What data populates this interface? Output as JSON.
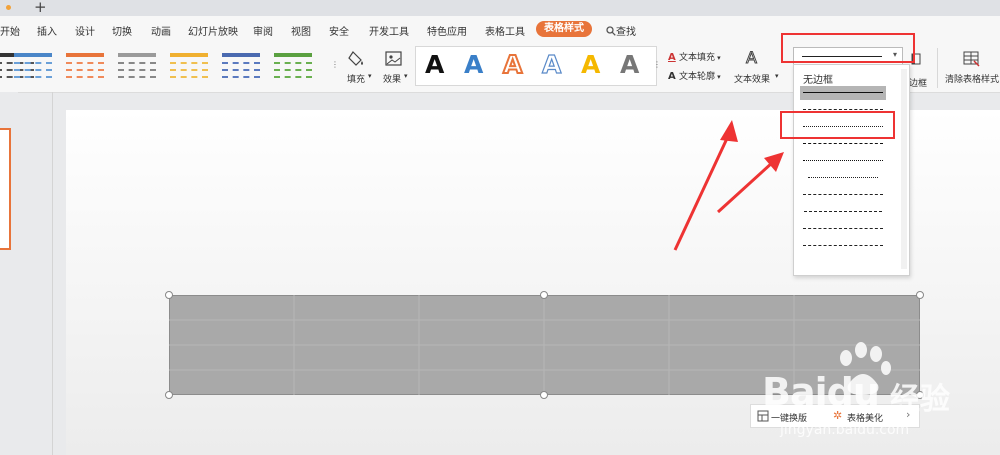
{
  "menu": {
    "items": [
      "开始",
      "插入",
      "设计",
      "切换",
      "动画",
      "幻灯片放映",
      "审阅",
      "视图",
      "安全",
      "开发工具",
      "特色应用",
      "表格工具"
    ],
    "active": "表格样式",
    "search": "查找"
  },
  "ribbon": {
    "fill_label": "填充",
    "effect_label": "效果",
    "text_fill_label": "文本填充",
    "text_outline_label": "文本轮廓",
    "text_effect_label": "文本效果",
    "border_label": "边框",
    "clear_style_label": "清除表格样式",
    "wordart_glyph": "A"
  },
  "dropdown": {
    "no_border_label": "无边框",
    "options": [
      "solid",
      "dashed-long",
      "dotted-fine",
      "dash-dot-dense",
      "dash-dot-dot-dense",
      "dotted",
      "dashed",
      "long-dashed",
      "dash-dot",
      "long-dash-dot"
    ],
    "selected": "solid"
  },
  "table_toolbar": {
    "one_click_label": "一键换版",
    "beautify_label": "表格美化"
  },
  "watermark": {
    "brand": "Baidu",
    "cn": "经验",
    "url": "jingyan.baidu.com"
  },
  "colors": {
    "accent": "#e8743a",
    "annotation": "#ee3333",
    "table_fill": "#a9a9a9"
  }
}
